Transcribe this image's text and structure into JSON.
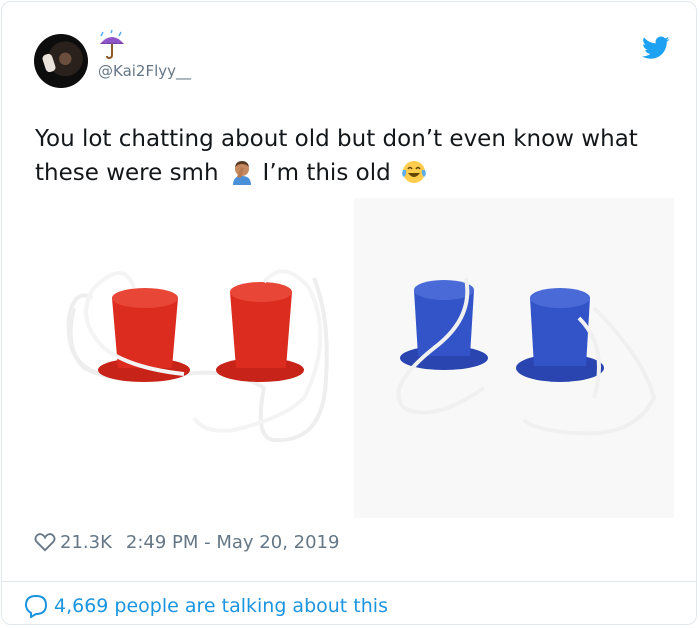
{
  "tweet": {
    "handle": "@Kai2Flyy__",
    "text_line1": "You lot chatting about old but don’t even know what",
    "text_line2_a": "these were smh",
    "text_line2_b": "I’m this old",
    "likes": "21.3K",
    "timestamp": "2:49 PM - May 20, 2019",
    "talking": "4,669 people are talking about this"
  },
  "icons": {
    "avatar": "profile-photo",
    "name_emoji": "umbrella-with-rain-emoji",
    "twitter": "twitter-bird-icon",
    "facepalm": "man-facepalming-emoji",
    "laugh": "face-with-tears-of-joy-emoji",
    "like": "heart-outline-icon",
    "conversation": "speech-bubble-icon"
  },
  "colors": {
    "twitter_blue": "#1da1f2",
    "link_blue": "#1b95e0",
    "muted_text": "#657786",
    "border": "#e1e8ed",
    "red_stilts": "#d9281c",
    "blue_stilts": "#2f4fc4"
  }
}
